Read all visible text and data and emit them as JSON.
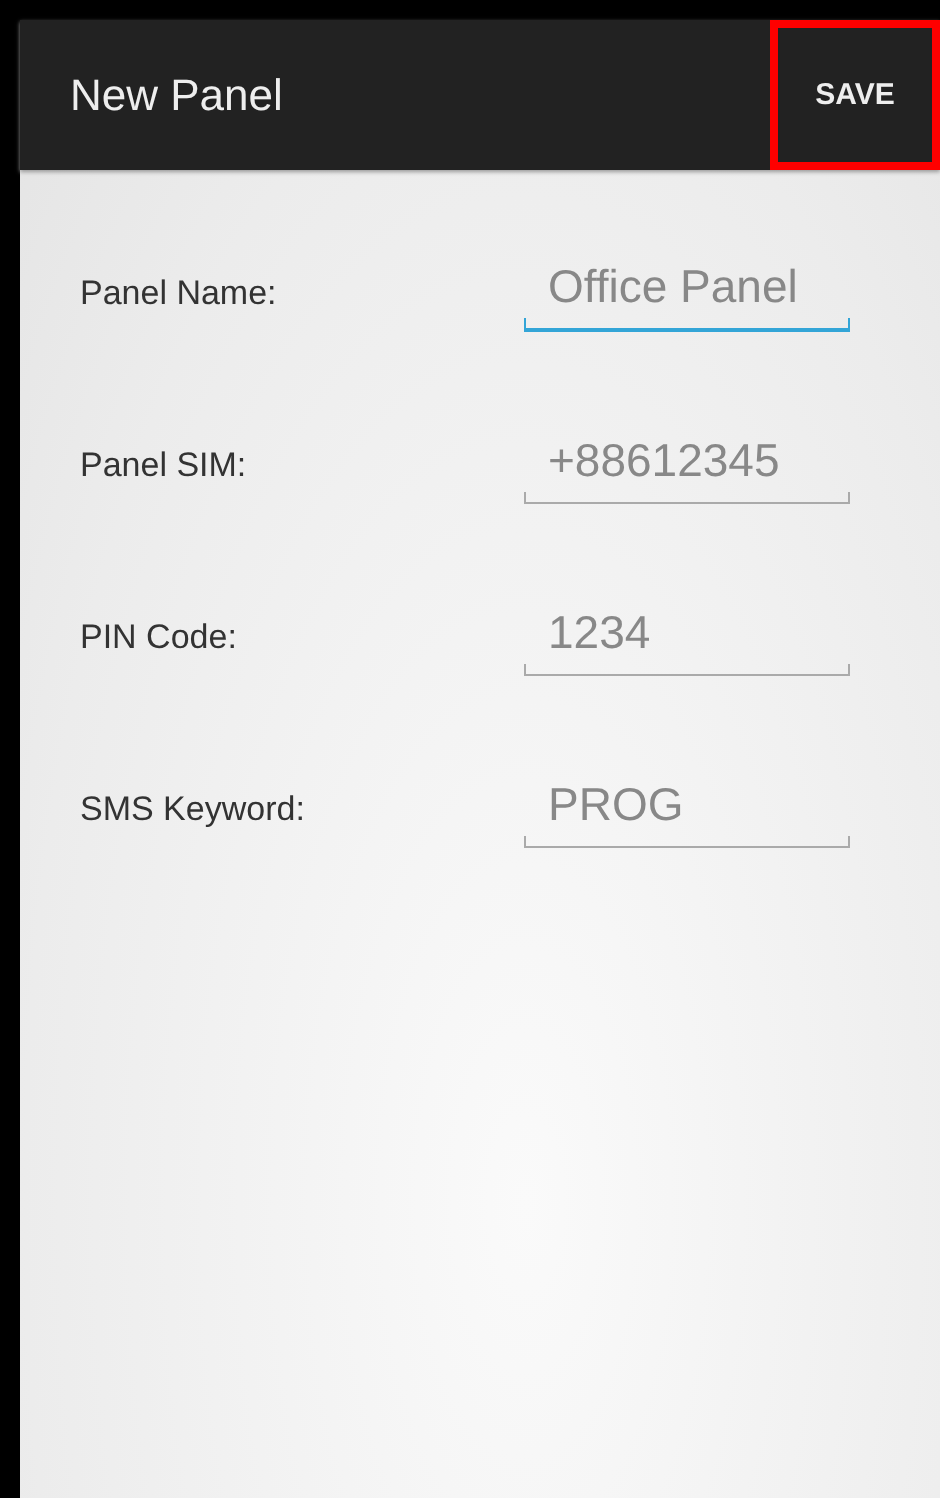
{
  "action_bar": {
    "title": "New Panel",
    "save_button": {
      "label": "SAVE",
      "highlighted": true
    }
  },
  "fields": [
    {
      "label": "Panel Name:",
      "placeholder": "Office Panel",
      "focused": true
    },
    {
      "label": "Panel SIM:",
      "placeholder": "+88612345",
      "focused": false
    },
    {
      "label": "PIN Code:",
      "placeholder": "1234",
      "focused": false
    },
    {
      "label": "SMS Keyword:",
      "placeholder": "PROG",
      "focused": false
    }
  ]
}
